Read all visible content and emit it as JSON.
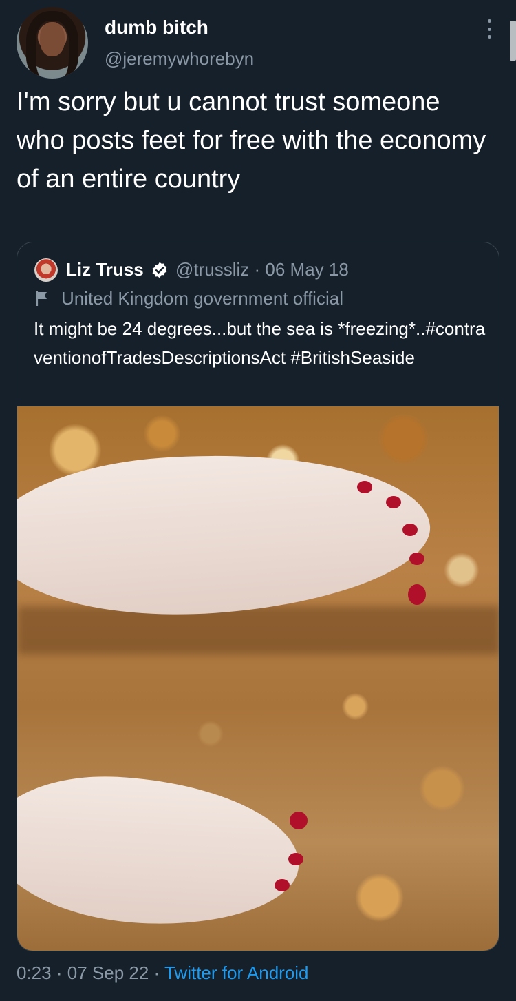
{
  "tweet": {
    "display_name": "dumb bitch",
    "handle": "@jeremywhorebyn",
    "text": "I'm sorry but u cannot trust someone who posts feet for free with the economy of an entire country",
    "time": "0:23",
    "separator": "·",
    "date": "07 Sep 22",
    "source": "Twitter for Android"
  },
  "quoted_tweet": {
    "display_name": "Liz Truss",
    "handle_and_date": "@trussliz · 06 May 18",
    "account_label": "United Kingdom government official",
    "text": "It might be 24 degrees...but the sea is *freezing*..#contraventionofTradesDescriptionsAct #BritishSeaside",
    "verified": true
  },
  "icons": {
    "more": "more-vertical-icon",
    "verified": "verified-badge-icon",
    "label": "flag-icon"
  },
  "colors": {
    "background": "#15202b",
    "primary_text": "#ffffff",
    "secondary_text": "#8b98a5",
    "link": "#1d9bf0",
    "border": "#38444d"
  }
}
